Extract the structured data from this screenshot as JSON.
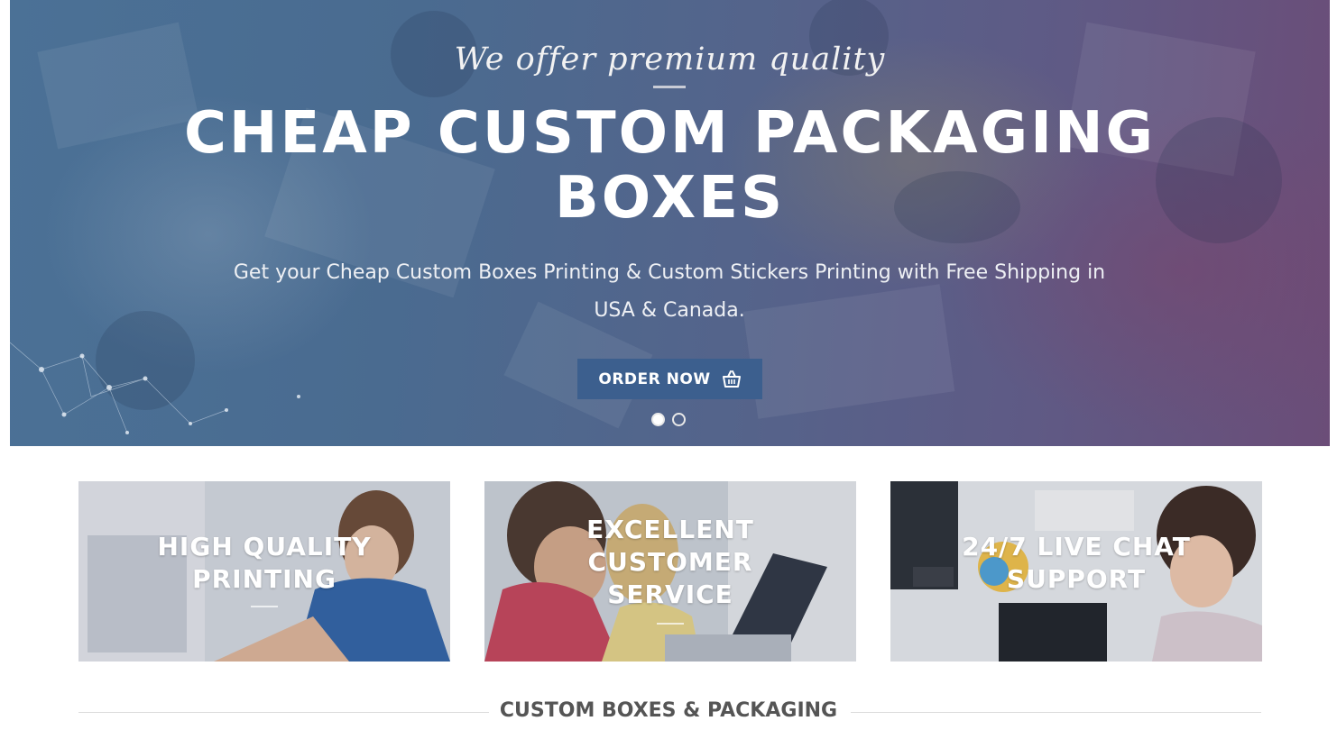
{
  "hero": {
    "tagline": "We offer premium quality",
    "title_line1": "CHEAP CUSTOM PACKAGING",
    "title_line2": "BOXES",
    "subtitle": "Get your Cheap Custom Boxes Printing & Custom Stickers Printing with Free Shipping in USA & Canada.",
    "cta_label": "ORDER NOW",
    "cta_icon": "basket-icon",
    "slides_total": 2,
    "active_slide": 1
  },
  "features": [
    {
      "line1": "HIGH QUALITY",
      "line2": "PRINTING"
    },
    {
      "line1": "EXCELLENT",
      "line2": "CUSTOMER",
      "line3": "SERVICE"
    },
    {
      "line1": "24/7 LIVE CHAT",
      "line2": "SUPPORT"
    }
  ],
  "section": {
    "heading": "CUSTOM BOXES & PACKAGING"
  },
  "colors": {
    "hero_overlay_start": "#4b7196",
    "hero_overlay_end": "#6b4d78",
    "cta_background": "#3c5f8e",
    "heading_text": "#555555"
  }
}
